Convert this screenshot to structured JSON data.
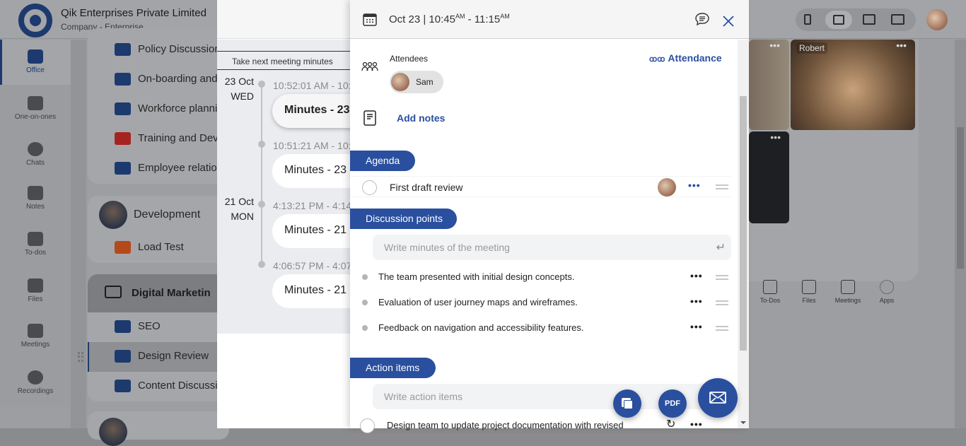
{
  "company": {
    "name": "Qik Enterprises Private Limited",
    "subtitle": "Company - Enterprise"
  },
  "left_nav": [
    {
      "label": "Office",
      "icon": "briefcase-icon",
      "active": true
    },
    {
      "label": "One-on-ones",
      "icon": "people-icon"
    },
    {
      "label": "Chats",
      "icon": "chat-bubbles-icon"
    },
    {
      "label": "Notes",
      "icon": "notes-icon"
    },
    {
      "label": "To-dos",
      "icon": "checkbox-icon"
    },
    {
      "label": "Files",
      "icon": "files-icon"
    },
    {
      "label": "Meetings",
      "icon": "meetings-icon"
    },
    {
      "label": "Recordings",
      "icon": "recording-icon"
    }
  ],
  "channels": {
    "hr_items": [
      {
        "label": "Policy Discussion",
        "color": "#1c3a6e"
      },
      {
        "label": "On-boarding and",
        "color": "#1c3a6e"
      },
      {
        "label": "Workforce planni",
        "color": "#1c3a6e"
      },
      {
        "label": "Training and Dev",
        "color": "#a52420"
      },
      {
        "label": "Employee relatio",
        "color": "#1c3a6e"
      }
    ],
    "development": {
      "title": "Development",
      "items": [
        {
          "label": "Load Test",
          "color": "#b5491a"
        }
      ]
    },
    "digital_marketing": {
      "title": "Digital Marketin",
      "items": [
        {
          "label": "SEO",
          "icon": "location-pin-icon"
        },
        {
          "label": "Design Review",
          "selected": true
        },
        {
          "label": "Content Discussi",
          "icon": "location-pin-icon"
        }
      ]
    }
  },
  "timeline": {
    "tab_label": "Take next meeting minutes",
    "groups": [
      {
        "day": "23 Oct",
        "weekday": "WED",
        "entries": [
          {
            "time": "10:52:01 AM - 10:",
            "title": "Minutes - 23",
            "selected": true
          },
          {
            "time": "10:51:21 AM - 10:",
            "title": "Minutes - 23"
          }
        ]
      },
      {
        "day": "21 Oct",
        "weekday": "MON",
        "entries": [
          {
            "time": "4:13:21 PM - 4:14:",
            "title": "Minutes - 21"
          },
          {
            "time": "4:06:57 PM - 4:07:",
            "title": "Minutes - 21"
          }
        ]
      }
    ]
  },
  "meeting": {
    "date_label": "Oct 23 | 10:45",
    "start_suffix": "AM",
    "separator": " - 11:15",
    "end_suffix": "AM",
    "attendees_label": "Attendees",
    "attendance_link": "Attendance",
    "attendees": [
      {
        "name": "Sam"
      }
    ],
    "add_notes_label": "Add notes",
    "agenda": {
      "label": "Agenda",
      "items": [
        {
          "text": "First draft review"
        }
      ]
    },
    "discussion": {
      "label": "Discussion points",
      "placeholder": "Write minutes of the meeting",
      "items": [
        {
          "text": "The team presented with initial design concepts."
        },
        {
          "text": "Evaluation of user journey maps and wireframes."
        },
        {
          "text": "Feedback on navigation and accessibility features."
        }
      ]
    },
    "actions": {
      "label": "Action items",
      "placeholder": "Write action items",
      "items": [
        {
          "text": "Design team to update project documentation with revised"
        }
      ]
    },
    "fab": {
      "copy": "copy-icon",
      "pdf_label": "PDF",
      "email": "email-icon"
    }
  },
  "right": {
    "tile_name": "Robert",
    "toolbar": [
      "To-Dos",
      "Files",
      "Meetings",
      "Apps"
    ]
  }
}
